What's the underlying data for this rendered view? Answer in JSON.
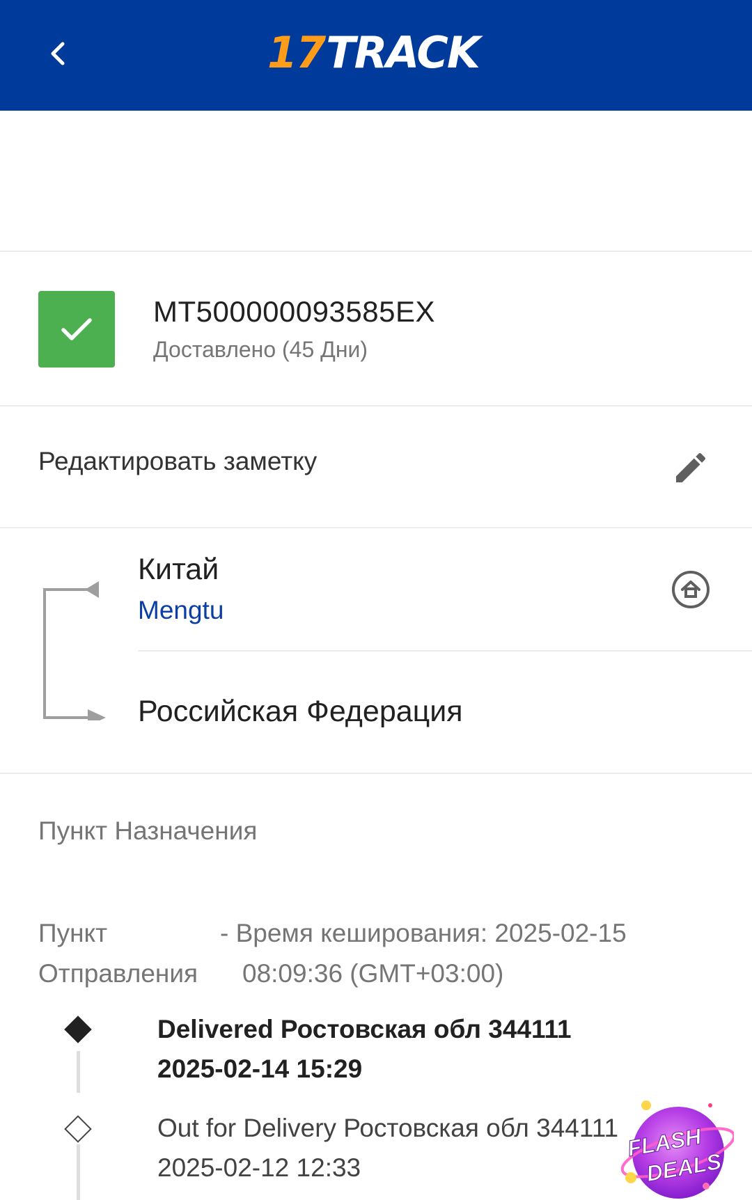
{
  "header": {
    "logo_number": "17",
    "logo_text": "TRACK"
  },
  "tracking": {
    "number": "MT500000093585EX",
    "status": "Доставлено (45 Дни)",
    "status_color": "#4caf50"
  },
  "note": {
    "edit_label": "Редактировать заметку"
  },
  "route": {
    "origin_country": "Китай",
    "origin_carrier": "Mengtu",
    "destination_country": "Российская Федерация"
  },
  "destination_section": {
    "title": "Пункт Назначения"
  },
  "origin_section": {
    "label_line1": "Пункт",
    "label_line2": "Отправления",
    "cache_line1": "- Время кеширования: 2025-02-15",
    "cache_line2": "08:09:36 (GMT+03:00)"
  },
  "events": [
    {
      "description": "Delivered Ростовская обл 344111",
      "time": "2025-02-14 15:29"
    },
    {
      "description": "Out for Delivery Ростовская обл 344111",
      "time": "2025-02-12 12:33"
    }
  ],
  "promo": {
    "line1": "FLASH",
    "line2": "DEALS"
  },
  "colors": {
    "header_bg": "#003a9b",
    "logo_accent": "#ff9c1a",
    "link": "#0b3fa4"
  },
  "icons": [
    "back-arrow-icon",
    "checkmark-icon",
    "pencil-icon",
    "home-icon",
    "route-bracket-icon"
  ]
}
